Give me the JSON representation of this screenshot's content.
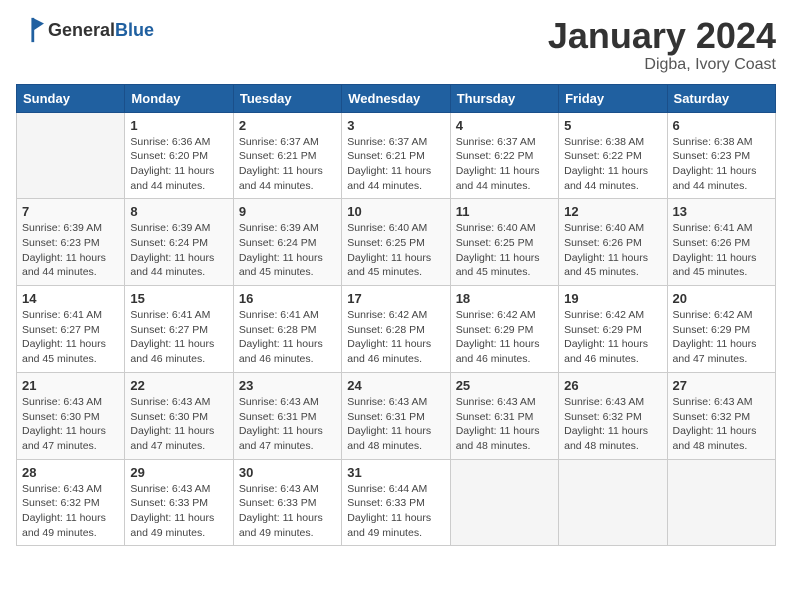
{
  "header": {
    "logo_general": "General",
    "logo_blue": "Blue",
    "month_year": "January 2024",
    "location": "Digba, Ivory Coast"
  },
  "days_of_week": [
    "Sunday",
    "Monday",
    "Tuesday",
    "Wednesday",
    "Thursday",
    "Friday",
    "Saturday"
  ],
  "weeks": [
    [
      {
        "day": "",
        "sunrise": "",
        "sunset": "",
        "daylight": ""
      },
      {
        "day": "1",
        "sunrise": "Sunrise: 6:36 AM",
        "sunset": "Sunset: 6:20 PM",
        "daylight": "Daylight: 11 hours and 44 minutes."
      },
      {
        "day": "2",
        "sunrise": "Sunrise: 6:37 AM",
        "sunset": "Sunset: 6:21 PM",
        "daylight": "Daylight: 11 hours and 44 minutes."
      },
      {
        "day": "3",
        "sunrise": "Sunrise: 6:37 AM",
        "sunset": "Sunset: 6:21 PM",
        "daylight": "Daylight: 11 hours and 44 minutes."
      },
      {
        "day": "4",
        "sunrise": "Sunrise: 6:37 AM",
        "sunset": "Sunset: 6:22 PM",
        "daylight": "Daylight: 11 hours and 44 minutes."
      },
      {
        "day": "5",
        "sunrise": "Sunrise: 6:38 AM",
        "sunset": "Sunset: 6:22 PM",
        "daylight": "Daylight: 11 hours and 44 minutes."
      },
      {
        "day": "6",
        "sunrise": "Sunrise: 6:38 AM",
        "sunset": "Sunset: 6:23 PM",
        "daylight": "Daylight: 11 hours and 44 minutes."
      }
    ],
    [
      {
        "day": "7",
        "sunrise": "Sunrise: 6:39 AM",
        "sunset": "Sunset: 6:23 PM",
        "daylight": "Daylight: 11 hours and 44 minutes."
      },
      {
        "day": "8",
        "sunrise": "Sunrise: 6:39 AM",
        "sunset": "Sunset: 6:24 PM",
        "daylight": "Daylight: 11 hours and 44 minutes."
      },
      {
        "day": "9",
        "sunrise": "Sunrise: 6:39 AM",
        "sunset": "Sunset: 6:24 PM",
        "daylight": "Daylight: 11 hours and 45 minutes."
      },
      {
        "day": "10",
        "sunrise": "Sunrise: 6:40 AM",
        "sunset": "Sunset: 6:25 PM",
        "daylight": "Daylight: 11 hours and 45 minutes."
      },
      {
        "day": "11",
        "sunrise": "Sunrise: 6:40 AM",
        "sunset": "Sunset: 6:25 PM",
        "daylight": "Daylight: 11 hours and 45 minutes."
      },
      {
        "day": "12",
        "sunrise": "Sunrise: 6:40 AM",
        "sunset": "Sunset: 6:26 PM",
        "daylight": "Daylight: 11 hours and 45 minutes."
      },
      {
        "day": "13",
        "sunrise": "Sunrise: 6:41 AM",
        "sunset": "Sunset: 6:26 PM",
        "daylight": "Daylight: 11 hours and 45 minutes."
      }
    ],
    [
      {
        "day": "14",
        "sunrise": "Sunrise: 6:41 AM",
        "sunset": "Sunset: 6:27 PM",
        "daylight": "Daylight: 11 hours and 45 minutes."
      },
      {
        "day": "15",
        "sunrise": "Sunrise: 6:41 AM",
        "sunset": "Sunset: 6:27 PM",
        "daylight": "Daylight: 11 hours and 46 minutes."
      },
      {
        "day": "16",
        "sunrise": "Sunrise: 6:41 AM",
        "sunset": "Sunset: 6:28 PM",
        "daylight": "Daylight: 11 hours and 46 minutes."
      },
      {
        "day": "17",
        "sunrise": "Sunrise: 6:42 AM",
        "sunset": "Sunset: 6:28 PM",
        "daylight": "Daylight: 11 hours and 46 minutes."
      },
      {
        "day": "18",
        "sunrise": "Sunrise: 6:42 AM",
        "sunset": "Sunset: 6:29 PM",
        "daylight": "Daylight: 11 hours and 46 minutes."
      },
      {
        "day": "19",
        "sunrise": "Sunrise: 6:42 AM",
        "sunset": "Sunset: 6:29 PM",
        "daylight": "Daylight: 11 hours and 46 minutes."
      },
      {
        "day": "20",
        "sunrise": "Sunrise: 6:42 AM",
        "sunset": "Sunset: 6:29 PM",
        "daylight": "Daylight: 11 hours and 47 minutes."
      }
    ],
    [
      {
        "day": "21",
        "sunrise": "Sunrise: 6:43 AM",
        "sunset": "Sunset: 6:30 PM",
        "daylight": "Daylight: 11 hours and 47 minutes."
      },
      {
        "day": "22",
        "sunrise": "Sunrise: 6:43 AM",
        "sunset": "Sunset: 6:30 PM",
        "daylight": "Daylight: 11 hours and 47 minutes."
      },
      {
        "day": "23",
        "sunrise": "Sunrise: 6:43 AM",
        "sunset": "Sunset: 6:31 PM",
        "daylight": "Daylight: 11 hours and 47 minutes."
      },
      {
        "day": "24",
        "sunrise": "Sunrise: 6:43 AM",
        "sunset": "Sunset: 6:31 PM",
        "daylight": "Daylight: 11 hours and 48 minutes."
      },
      {
        "day": "25",
        "sunrise": "Sunrise: 6:43 AM",
        "sunset": "Sunset: 6:31 PM",
        "daylight": "Daylight: 11 hours and 48 minutes."
      },
      {
        "day": "26",
        "sunrise": "Sunrise: 6:43 AM",
        "sunset": "Sunset: 6:32 PM",
        "daylight": "Daylight: 11 hours and 48 minutes."
      },
      {
        "day": "27",
        "sunrise": "Sunrise: 6:43 AM",
        "sunset": "Sunset: 6:32 PM",
        "daylight": "Daylight: 11 hours and 48 minutes."
      }
    ],
    [
      {
        "day": "28",
        "sunrise": "Sunrise: 6:43 AM",
        "sunset": "Sunset: 6:32 PM",
        "daylight": "Daylight: 11 hours and 49 minutes."
      },
      {
        "day": "29",
        "sunrise": "Sunrise: 6:43 AM",
        "sunset": "Sunset: 6:33 PM",
        "daylight": "Daylight: 11 hours and 49 minutes."
      },
      {
        "day": "30",
        "sunrise": "Sunrise: 6:43 AM",
        "sunset": "Sunset: 6:33 PM",
        "daylight": "Daylight: 11 hours and 49 minutes."
      },
      {
        "day": "31",
        "sunrise": "Sunrise: 6:44 AM",
        "sunset": "Sunset: 6:33 PM",
        "daylight": "Daylight: 11 hours and 49 minutes."
      },
      {
        "day": "",
        "sunrise": "",
        "sunset": "",
        "daylight": ""
      },
      {
        "day": "",
        "sunrise": "",
        "sunset": "",
        "daylight": ""
      },
      {
        "day": "",
        "sunrise": "",
        "sunset": "",
        "daylight": ""
      }
    ]
  ]
}
